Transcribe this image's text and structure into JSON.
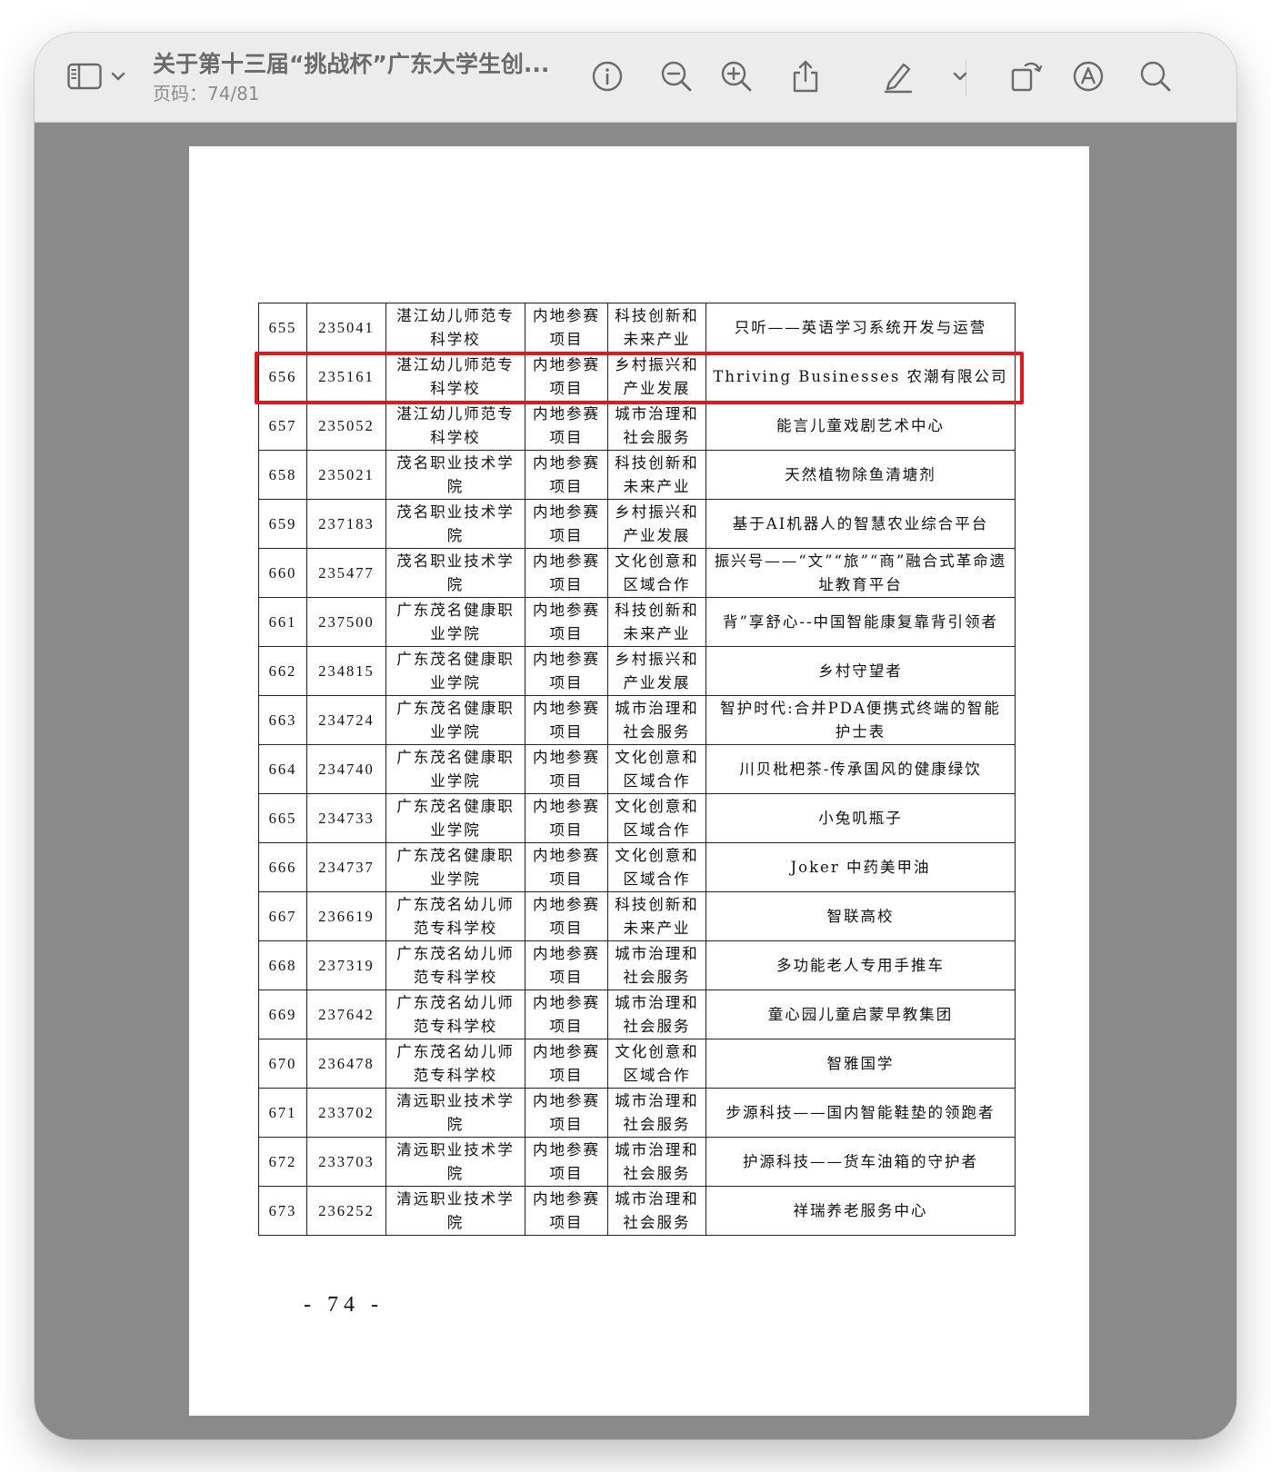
{
  "toolbar": {
    "doc_title": "关于第十三届“挑战杯”广东大学生创...",
    "page_indicator": "页码：74/81",
    "icons": [
      "sidebar-icon",
      "chevron-down-icon",
      "info-icon",
      "zoom-out-icon",
      "zoom-in-icon",
      "share-icon",
      "highlight-pen-icon",
      "chevron-down-icon",
      "rotate-icon",
      "markup-icon",
      "search-icon"
    ]
  },
  "highlight": {
    "row_no": "656",
    "color": "#e8161b"
  },
  "table": {
    "rows": [
      {
        "no": "655",
        "code": "235041",
        "school": "湛江幼儿师范专科学校",
        "type": "内地参赛项目",
        "track": "科技创新和未来产业",
        "project": "只听——英语学习系统开发与运营"
      },
      {
        "no": "656",
        "code": "235161",
        "school": "湛江幼儿师范专科学校",
        "type": "内地参赛项目",
        "track": "乡村振兴和产业发展",
        "project": "Thriving Businesses 农潮有限公司"
      },
      {
        "no": "657",
        "code": "235052",
        "school": "湛江幼儿师范专科学校",
        "type": "内地参赛项目",
        "track": "城市治理和社会服务",
        "project": "能言儿童戏剧艺术中心"
      },
      {
        "no": "658",
        "code": "235021",
        "school": "茂名职业技术学院",
        "type": "内地参赛项目",
        "track": "科技创新和未来产业",
        "project": "天然植物除鱼清塘剂"
      },
      {
        "no": "659",
        "code": "237183",
        "school": "茂名职业技术学院",
        "type": "内地参赛项目",
        "track": "乡村振兴和产业发展",
        "project": "基于AI机器人的智慧农业综合平台"
      },
      {
        "no": "660",
        "code": "235477",
        "school": "茂名职业技术学院",
        "type": "内地参赛项目",
        "track": "文化创意和区域合作",
        "project": "振兴号——“文”“旅”“商”融合式革命遗址教育平台"
      },
      {
        "no": "661",
        "code": "237500",
        "school": "广东茂名健康职业学院",
        "type": "内地参赛项目",
        "track": "科技创新和未来产业",
        "project": "背”享舒心--中国智能康复靠背引领者"
      },
      {
        "no": "662",
        "code": "234815",
        "school": "广东茂名健康职业学院",
        "type": "内地参赛项目",
        "track": "乡村振兴和产业发展",
        "project": "乡村守望者"
      },
      {
        "no": "663",
        "code": "234724",
        "school": "广东茂名健康职业学院",
        "type": "内地参赛项目",
        "track": "城市治理和社会服务",
        "project": "智护时代:合并PDA便携式终端的智能护士表"
      },
      {
        "no": "664",
        "code": "234740",
        "school": "广东茂名健康职业学院",
        "type": "内地参赛项目",
        "track": "文化创意和区域合作",
        "project": "川贝枇杷茶-传承国风的健康绿饮"
      },
      {
        "no": "665",
        "code": "234733",
        "school": "广东茂名健康职业学院",
        "type": "内地参赛项目",
        "track": "文化创意和区域合作",
        "project": "小兔叽瓶子"
      },
      {
        "no": "666",
        "code": "234737",
        "school": "广东茂名健康职业学院",
        "type": "内地参赛项目",
        "track": "文化创意和区域合作",
        "project": "Joker 中药美甲油"
      },
      {
        "no": "667",
        "code": "236619",
        "school": "广东茂名幼儿师范专科学校",
        "type": "内地参赛项目",
        "track": "科技创新和未来产业",
        "project": "智联高校"
      },
      {
        "no": "668",
        "code": "237319",
        "school": "广东茂名幼儿师范专科学校",
        "type": "内地参赛项目",
        "track": "城市治理和社会服务",
        "project": "多功能老人专用手推车"
      },
      {
        "no": "669",
        "code": "237642",
        "school": "广东茂名幼儿师范专科学校",
        "type": "内地参赛项目",
        "track": "城市治理和社会服务",
        "project": "童心园儿童启蒙早教集团"
      },
      {
        "no": "670",
        "code": "236478",
        "school": "广东茂名幼儿师范专科学校",
        "type": "内地参赛项目",
        "track": "文化创意和区域合作",
        "project": "智雅国学"
      },
      {
        "no": "671",
        "code": "233702",
        "school": "清远职业技术学院",
        "type": "内地参赛项目",
        "track": "城市治理和社会服务",
        "project": "步源科技——国内智能鞋垫的领跑者"
      },
      {
        "no": "672",
        "code": "233703",
        "school": "清远职业技术学院",
        "type": "内地参赛项目",
        "track": "城市治理和社会服务",
        "project": "护源科技——货车油箱的守护者"
      },
      {
        "no": "673",
        "code": "236252",
        "school": "清远职业技术学院",
        "type": "内地参赛项目",
        "track": "城市治理和社会服务",
        "project": "祥瑞养老服务中心"
      }
    ]
  },
  "page_footer": "- 74 -"
}
